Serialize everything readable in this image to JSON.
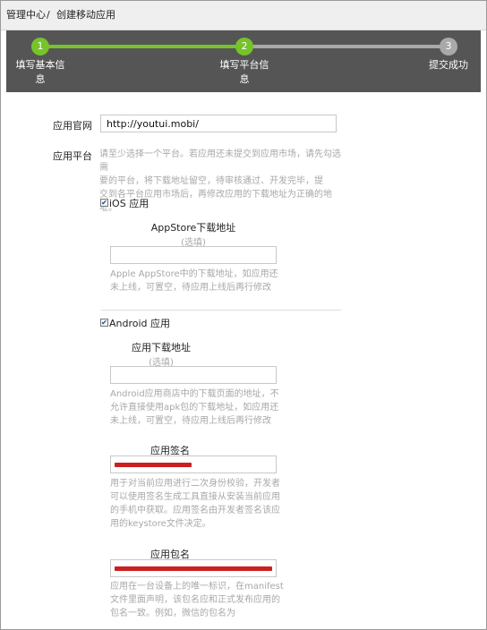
{
  "breadcrumb": {
    "root": "管理中心",
    "sep": "/",
    "current": "创建移动应用"
  },
  "steps": [
    {
      "number": "1",
      "label_line1": "填写基本信",
      "label_line2": "息",
      "state": "done"
    },
    {
      "number": "2",
      "label_line1": "填写平台信",
      "label_line2": "息",
      "state": "done"
    },
    {
      "number": "3",
      "label_line1": "提交成功",
      "label_line2": "",
      "state": "todo"
    }
  ],
  "website": {
    "label": "应用官网",
    "value": "http://youtui.mobi/"
  },
  "platform": {
    "label": "应用平台",
    "help": [
      "请至少选择一个平台。若应用还未提交到应用市场，请先勾选需",
      "要的平台，将下载地址留空，待审核通过、开发完毕，提",
      "交到各平台应用市场后，再修改应用的下载地址为正确的地址。"
    ]
  },
  "ios": {
    "checked": true,
    "label": "iOS 应用",
    "field_title": "AppStore下载地址",
    "optional": "(选填)",
    "value": "",
    "help": [
      "Apple AppStore中的下载地址，如应用还",
      "未上线，可置空，待应用上线后再行修改"
    ]
  },
  "android": {
    "checked": true,
    "label": "Android 应用",
    "download": {
      "title": "应用下载地址",
      "optional": "(选填)",
      "value": "",
      "help": [
        "Android应用商店中的下载页面的地址，不",
        "允许直接使用apk包的下载地址，如应用还",
        "未上线，可置空，待应用上线后再行修改"
      ]
    },
    "signature": {
      "title": "应用签名",
      "help": [
        "用于对当前应用进行二次身份校验，开发者",
        "可以使用签名生成工具直接从安装当前应用",
        "的手机中获取。应用签名由开发者签名该应",
        "用的keystore文件决定。"
      ]
    },
    "package": {
      "title": "应用包名",
      "help": [
        "应用在一台设备上的唯一标识，在manifest",
        "文件里面声明，该包名应和正式发布应用的",
        "包名一致。例如，微信的包名为"
      ]
    }
  },
  "colors": {
    "step_done": "#76c32a",
    "step_todo": "#a9a9a9",
    "stepper_bg": "#555555",
    "redaction": "#cc1f1f"
  }
}
